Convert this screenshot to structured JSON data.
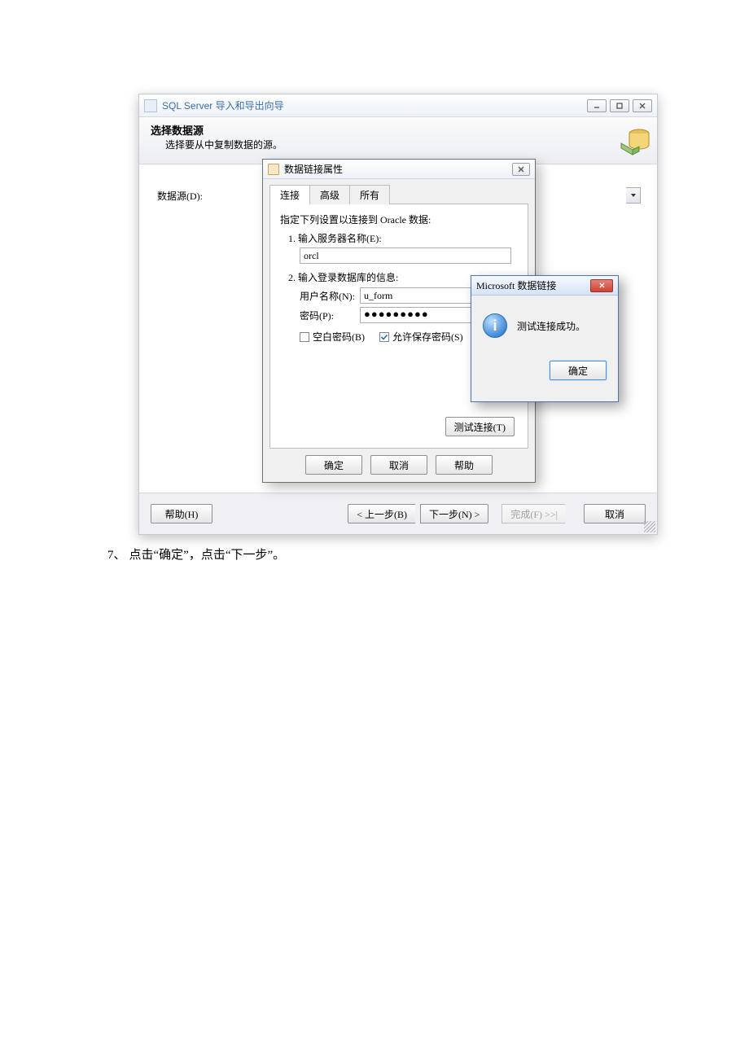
{
  "wizard": {
    "title": "SQL Server 导入和导出向导",
    "header_title": "选择数据源",
    "header_sub": "选择要从中复制数据的源。",
    "ds_label": "数据源(D):",
    "footer": {
      "help": "帮助(H)",
      "back": "< 上一步(B)",
      "next": "下一步(N) >",
      "finish": "完成(F) >>|",
      "cancel": "取消"
    }
  },
  "dlp": {
    "title": "数据链接属性",
    "tabs": {
      "conn": "连接",
      "adv": "高级",
      "all": "所有"
    },
    "hint": "指定下列设置以连接到 Oracle 数据:",
    "step1": "1. 输入服务器名称(E):",
    "server_value": "orcl",
    "step2": "2. 输入登录数据库的信息:",
    "user_label": "用户名称(N):",
    "user_value": "u_form",
    "pw_label": "密码(P):",
    "pw_value": "●●●●●●●●●",
    "blank_pw": "空白密码(B)",
    "allow_save_pw": "允许保存密码(S)",
    "test": "测试连接(T)",
    "ok": "确定",
    "cancel": "取消",
    "help_btn": "帮助"
  },
  "msg": {
    "title": "Microsoft 数据链接",
    "text": "测试连接成功。",
    "ok": "确定"
  },
  "caption": {
    "num": "7、",
    "text": "点击“确定”，点击“下一步”。"
  }
}
